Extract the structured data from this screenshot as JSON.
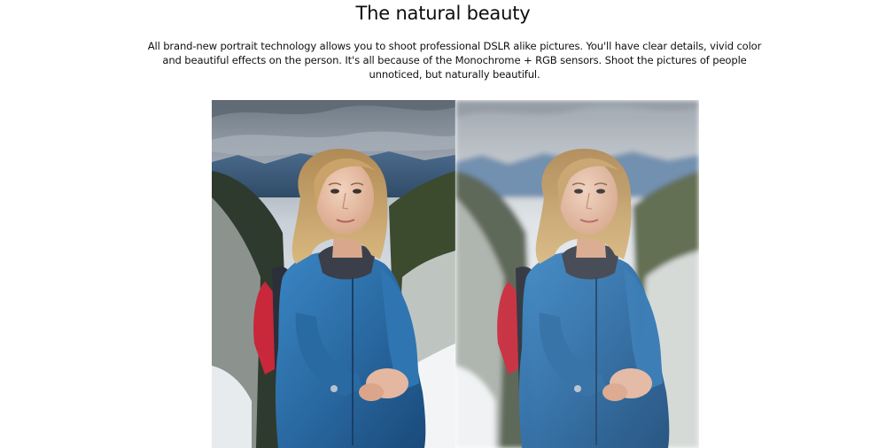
{
  "header": {
    "title": "The natural beauty"
  },
  "content": {
    "description": "All brand-new portrait technology allows you to shoot professional DSLR alike pictures. You'll have clear details, vivid color and beautiful effects on the person. It's all because of the Monochrome + RGB sensors. Shoot the pictures of people unnoticed, but naturally beautiful."
  },
  "comparison": {
    "left_photo": "portrait-standard",
    "right_photo": "portrait-bokeh"
  },
  "colors": {
    "jacket": "#2a6aa3",
    "backpack": "#c8283a",
    "sky": "#c9d3dc",
    "hair": "#c9a36a"
  }
}
